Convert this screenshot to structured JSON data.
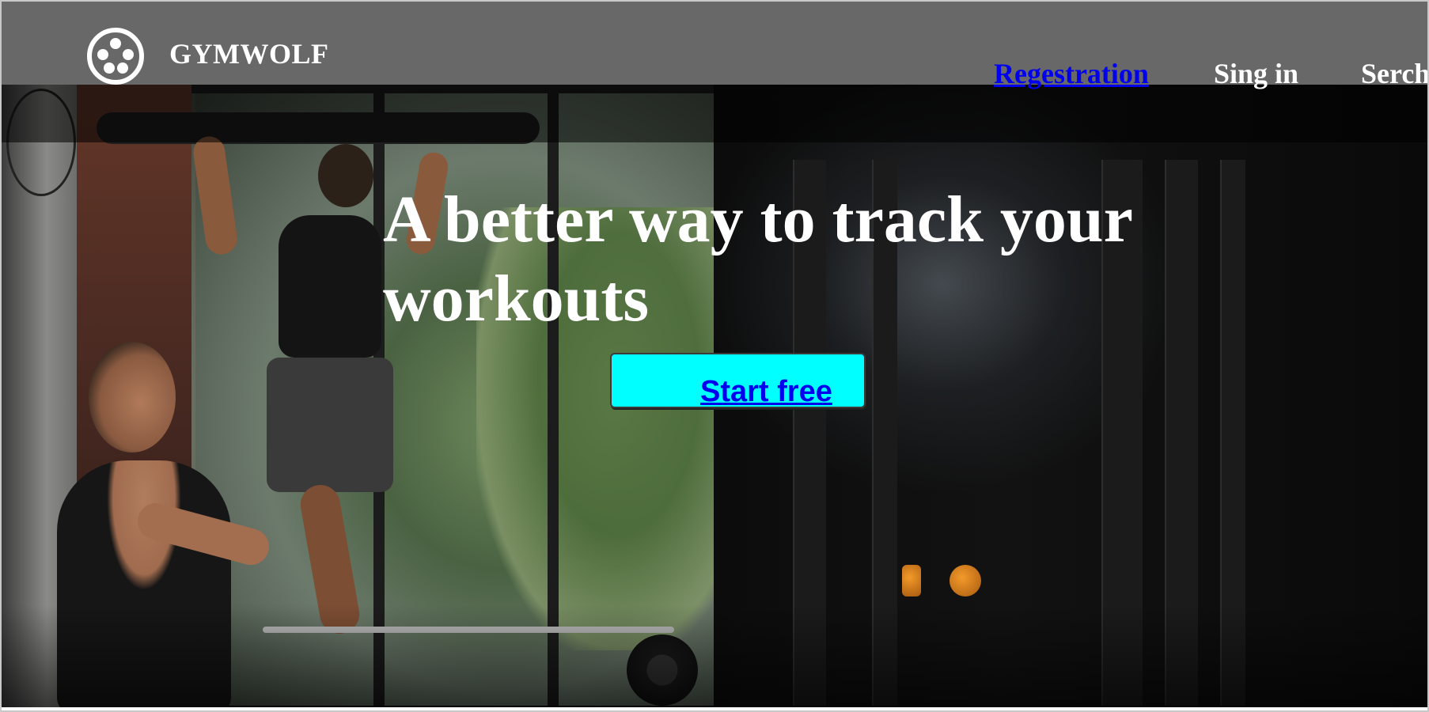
{
  "header": {
    "brand": "GYMWOLF",
    "logo_icon": "wolf-paw-badge-icon",
    "background_color": "#686868"
  },
  "nav": {
    "registration": "Regestration",
    "sign_in": "Sing in",
    "search": "Serch",
    "link_color": "#0000ee"
  },
  "hero": {
    "headline": "A better way to track your workouts",
    "background": "gym photo: man doing pull-ups, woman on seated cable row"
  },
  "cta": {
    "label": "Start free",
    "background_color": "#00ffff"
  }
}
